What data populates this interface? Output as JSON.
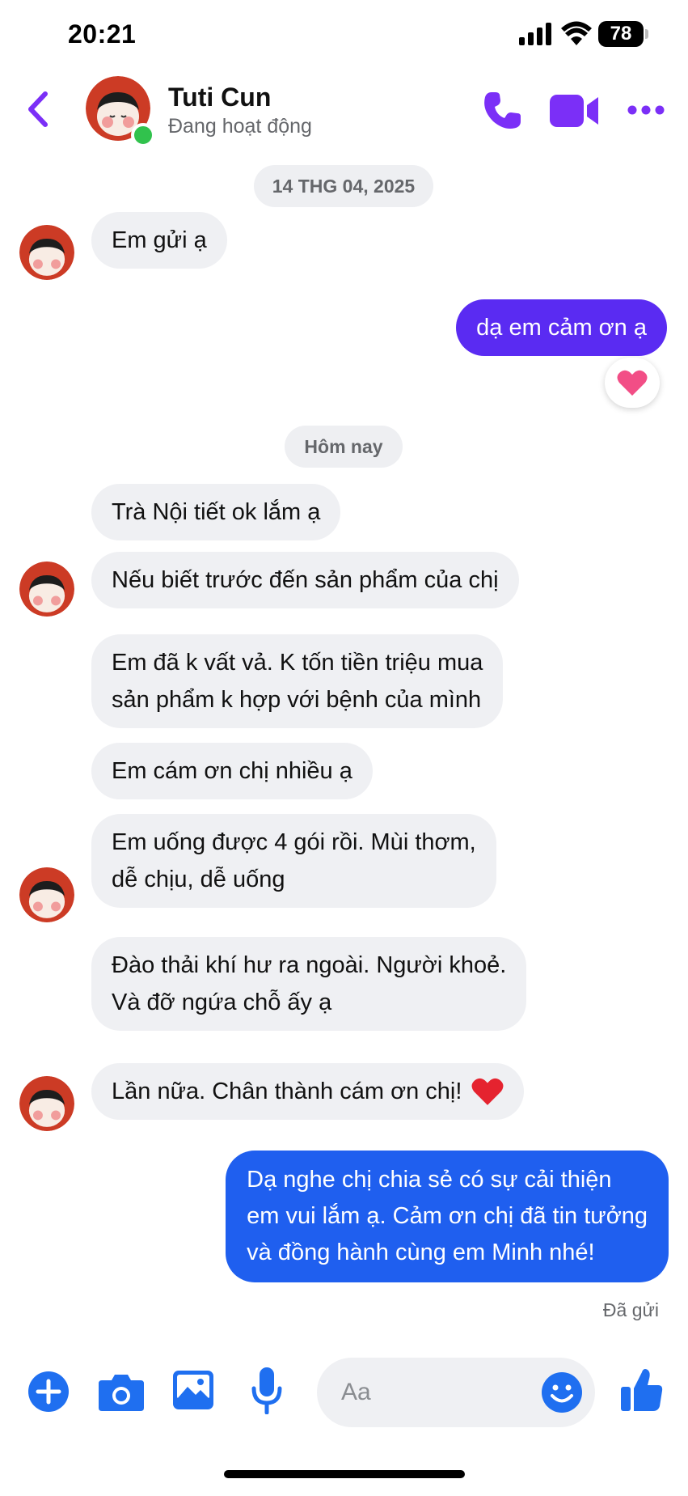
{
  "status_bar": {
    "time": "20:21",
    "battery": "78"
  },
  "header": {
    "contact_name": "Tuti Cun",
    "contact_status": "Đang hoạt động"
  },
  "date_dividers": {
    "first": "14 THG 04, 2025",
    "second": "Hôm nay"
  },
  "messages": [
    {
      "id": "m1",
      "direction": "in",
      "text": "Em gửi ạ"
    },
    {
      "id": "m2",
      "direction": "out",
      "text": "dạ em cảm ơn ạ",
      "reaction": "pink-heart"
    },
    {
      "id": "m3",
      "direction": "in",
      "text": "Trà Nội tiết ok lắm ạ"
    },
    {
      "id": "m4",
      "direction": "in",
      "text": "Nếu biết trước đến sản phẩm của chị"
    },
    {
      "id": "m5",
      "direction": "in",
      "text": "Em đã k vất vả. K tốn tiền triệu mua\nsản phẩm k hợp với bệnh của mình"
    },
    {
      "id": "m6",
      "direction": "in",
      "text": "Em cám ơn chị nhiều ạ"
    },
    {
      "id": "m7",
      "direction": "in",
      "text": "Em uống được 4 gói rồi. Mùi thơm,\ndễ chịu, dễ uống"
    },
    {
      "id": "m8",
      "direction": "in",
      "text": "Đào thải khí hư ra ngoài. Người khoẻ.\nVà đỡ ngứa chỗ ấy ạ"
    },
    {
      "id": "m9",
      "direction": "in",
      "text": "Lần nữa. Chân thành cám ơn chị!",
      "emoji": "red-heart"
    },
    {
      "id": "m10",
      "direction": "out",
      "text": "Dạ nghe chị chia sẻ có sự cải thiện\nem vui lắm ạ. Cảm ơn chị đã tin tưởng\nvà đồng hành cùng em Minh nhé!"
    }
  ],
  "sent_status": "Đã gửi",
  "composer": {
    "placeholder": "Aa"
  },
  "colors": {
    "accent_purple": "#7b2ff7",
    "outgoing_purple": "#5a2bf2",
    "outgoing_blue": "#1f5fef",
    "composer_blue": "#1f6ff0",
    "incoming_bg": "#eff0f3",
    "online_green": "#31c24d"
  },
  "icons": [
    "back-chevron-icon",
    "phone-icon",
    "video-camera-icon",
    "more-dots-icon",
    "plus-circle-icon",
    "camera-icon",
    "photo-icon",
    "microphone-icon",
    "emoji-icon",
    "thumbs-up-icon"
  ]
}
